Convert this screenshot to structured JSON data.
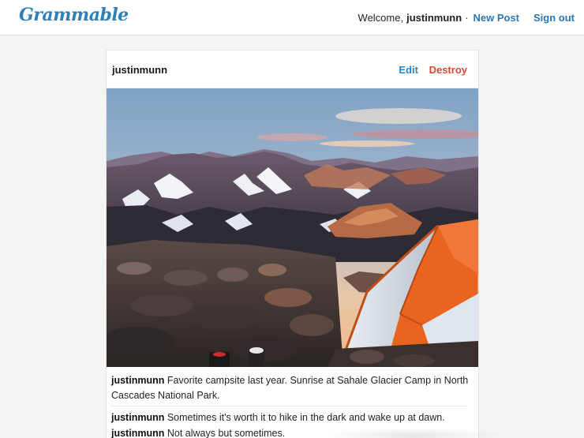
{
  "nav": {
    "logo": "Grammable",
    "welcome_text": "Welcome,",
    "username": "justinmunn",
    "separator": "·",
    "new_post_label": "New Post",
    "sign_out_label": "Sign out"
  },
  "post": {
    "author": "justinmunn",
    "edit_label": "Edit",
    "destroy_label": "Destroy",
    "image_description": "Orange tent on rocky summit with mountain range at sunrise",
    "caption": {
      "author": "justinmunn",
      "text": "Favorite campsite last year. Sunrise at Sahale Glacier Camp in North Cascades National Park."
    },
    "comments": [
      {
        "author": "justinmunn",
        "text": "Sometimes it's worth it to hike in the dark and wake up at dawn."
      },
      {
        "author": "justinmunn",
        "text": "Not always but sometimes."
      }
    ]
  },
  "colors": {
    "link": "#2b78b8",
    "destroy": "#e0452f",
    "tent": "#e8641f"
  }
}
